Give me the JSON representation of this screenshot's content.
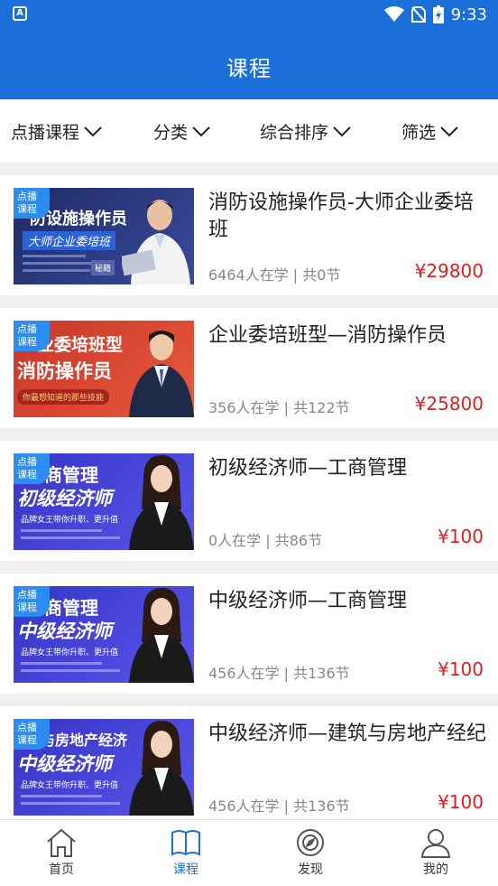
{
  "status": {
    "time": "9:33",
    "app_icon": "A"
  },
  "header": {
    "title": "课程"
  },
  "filters": [
    {
      "label": "点播课程"
    },
    {
      "label": "分类"
    },
    {
      "label": "综合排序"
    },
    {
      "label": "筛选"
    }
  ],
  "courses": [
    {
      "tag_line1": "点播",
      "tag_line2": "课程",
      "thumb_title": "防设施操作员",
      "thumb_sub": "大师企业委培班",
      "thumb_badge": "秘籍",
      "title": "消防设施操作员-大师企业委培班",
      "meta": "6464人在学 | 共0节",
      "price": "¥29800",
      "thumb_color": "#22306e"
    },
    {
      "tag_line1": "点播",
      "tag_line2": "课程",
      "thumb_title": "业委培班型",
      "thumb_sub": "消防操作员",
      "thumb_badge": "你最想知道的那些技能",
      "title": "企业委培班型—消防操作员",
      "meta": "356人在学 | 共122节",
      "price": "¥25800",
      "thumb_color": "#d9402f"
    },
    {
      "tag_line1": "点播",
      "tag_line2": "课程",
      "thumb_title": "商管理",
      "thumb_sub": "初级经济师",
      "thumb_badge": "品牌女王带你升职、更升值",
      "title": "初级经济师—工商管理",
      "meta": "0人在学 | 共86节",
      "price": "¥100",
      "thumb_color": "#3d3fd8"
    },
    {
      "tag_line1": "点播",
      "tag_line2": "课程",
      "thumb_title": "商管理",
      "thumb_sub": "中级经济师",
      "thumb_badge": "品牌女王带你升职、更升值",
      "title": "中级经济师—工商管理",
      "meta": "456人在学 | 共136节",
      "price": "¥100",
      "thumb_color": "#3d3fd8"
    },
    {
      "tag_line1": "点播",
      "tag_line2": "课程",
      "thumb_title": "与房地产经济",
      "thumb_sub": "中级经济师",
      "thumb_badge": "品牌女王带你升职、更升值",
      "title": "中级经济师—建筑与房地产经纪",
      "meta": "456人在学 | 共136节",
      "price": "¥100",
      "thumb_color": "#3d3fd8"
    }
  ],
  "nav": [
    {
      "label": "首页",
      "icon": "home-icon"
    },
    {
      "label": "课程",
      "icon": "book-icon"
    },
    {
      "label": "发现",
      "icon": "discover-icon"
    },
    {
      "label": "我的",
      "icon": "profile-icon"
    }
  ],
  "colors": {
    "header": "#1a6fd9",
    "price": "#e02020",
    "tag": "#2d8cf0",
    "nav_active": "#1a6fd9"
  }
}
